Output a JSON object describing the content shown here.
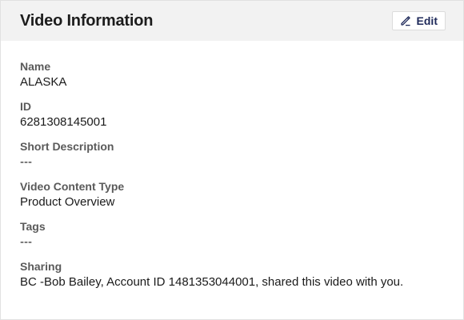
{
  "header": {
    "title": "Video Information",
    "edit_label": "Edit"
  },
  "icons": {
    "edit": "pencil-icon"
  },
  "colors": {
    "header_bg": "#f2f2f2",
    "edit_text": "#1f2a5a",
    "label_text": "#5a5a5a"
  },
  "fields": [
    {
      "label": "Name",
      "value": "ALASKA"
    },
    {
      "label": "ID",
      "value": "6281308145001"
    },
    {
      "label": "Short Description",
      "value": "---"
    },
    {
      "label": "Video Content Type",
      "value": "Product Overview"
    },
    {
      "label": "Tags",
      "value": "---"
    },
    {
      "label": "Sharing",
      "value": "BC -Bob Bailey, Account ID 1481353044001, shared this video with you."
    }
  ]
}
